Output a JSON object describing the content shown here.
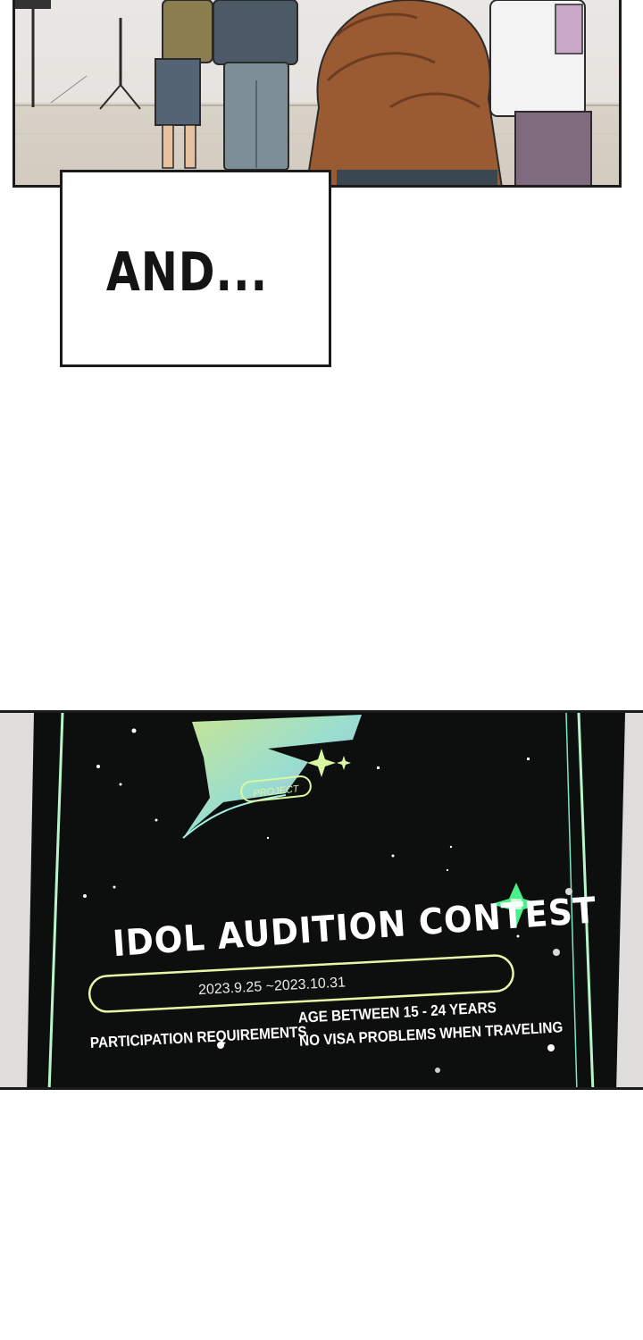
{
  "caption": {
    "text": "AND..."
  },
  "poster": {
    "logo_project": "PROJECT",
    "title": "IDOL AUDITION CONTEST",
    "dates": "2023.9.25 ~2023.10.31",
    "requirements_label": "PARTICIPATION REQUIREMENTS",
    "requirement_lines": [
      "AGE BETWEEN 15 - 24 YEARS",
      "NO VISA PROBLEMS WHEN TRAVELING"
    ]
  },
  "colors": {
    "panel_border": "#1b1b1b",
    "poster_background": "#0d0f0e",
    "poster_glow": "#b8f5c8",
    "sparkle_green": "#4bf08a"
  }
}
